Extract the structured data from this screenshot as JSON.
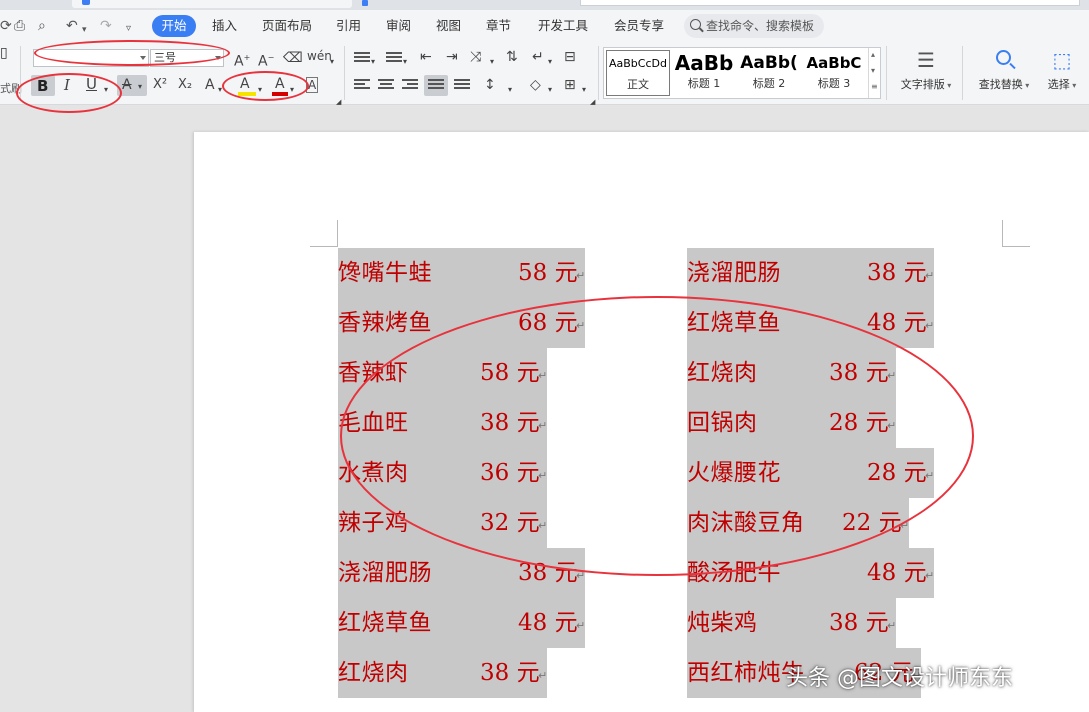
{
  "menu": {
    "items": [
      "开始",
      "插入",
      "页面布局",
      "引用",
      "审阅",
      "视图",
      "章节",
      "开发工具",
      "会员专享"
    ],
    "active": "开始",
    "search_placeholder": "查找命令、搜索模板"
  },
  "ribbon": {
    "format_painter_label": "式刷",
    "font_size": "三号",
    "style_gallery": [
      {
        "preview": "AaBbCcDd",
        "name": "正文"
      },
      {
        "preview": "AaBb",
        "name": "标题 1"
      },
      {
        "preview": "AaBb(",
        "name": "标题 2"
      },
      {
        "preview": "AaBbC",
        "name": "标题 3"
      }
    ],
    "text_layout_label": "文字排版",
    "find_replace_label": "查找替换",
    "select_label": "选择",
    "bold": "B",
    "italic": "I",
    "underline": "U",
    "font_color_glyph": "A",
    "highlight_glyph": "A",
    "superscript": "X²",
    "subscript": "X₂"
  },
  "document": {
    "left_column": [
      {
        "name": "馋嘴牛蛙",
        "price": "58 元"
      },
      {
        "name": "香辣烤鱼",
        "price": "68 元"
      },
      {
        "name": "香辣虾",
        "price": "58 元"
      },
      {
        "name": "毛血旺",
        "price": "38 元"
      },
      {
        "name": "水煮肉",
        "price": "36 元"
      },
      {
        "name": "辣子鸡",
        "price": "32 元"
      },
      {
        "name": "浇溜肥肠",
        "price": "38 元"
      },
      {
        "name": "红烧草鱼",
        "price": "48 元"
      },
      {
        "name": "红烧肉",
        "price": "38 元"
      }
    ],
    "right_column": [
      {
        "name": "浇溜肥肠",
        "price": "38 元"
      },
      {
        "name": "红烧草鱼",
        "price": "48 元"
      },
      {
        "name": "红烧肉",
        "price": "38 元"
      },
      {
        "name": "回锅肉",
        "price": "28 元"
      },
      {
        "name": "火爆腰花",
        "price": "28 元"
      },
      {
        "name": "肉沫酸豆角",
        "price": "22 元"
      },
      {
        "name": "酸汤肥牛",
        "price": "48 元"
      },
      {
        "name": "炖柴鸡",
        "price": "38 元"
      },
      {
        "name": "西红柿炖牛",
        "price": "62 元"
      }
    ],
    "paragraph_mark": "↵"
  },
  "watermark": "头条 @图文设计师东东",
  "colors": {
    "accent": "#3a7ef3",
    "menu_text": "#c00000",
    "shading": "#c8c8c8",
    "annotation": "#e8323c"
  }
}
